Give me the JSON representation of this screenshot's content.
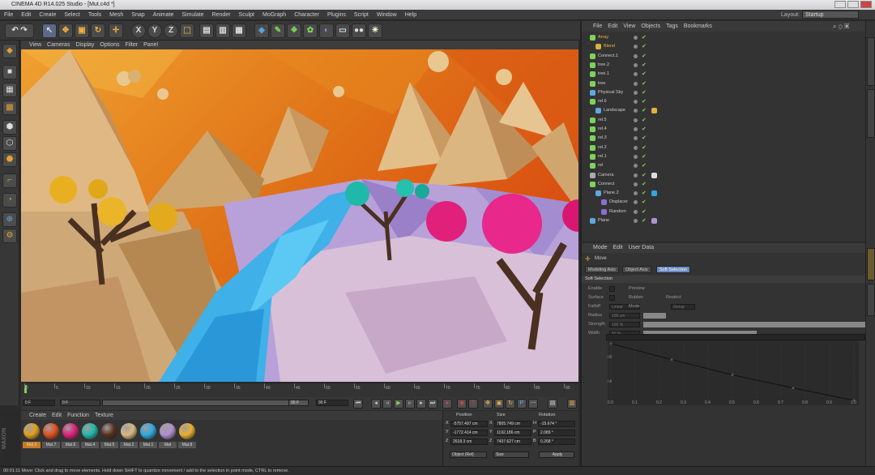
{
  "title": "CINEMA 4D R14.025 Studio - [Mut.c4d *]",
  "menus": [
    "File",
    "Edit",
    "Create",
    "Select",
    "Tools",
    "Mesh",
    "Snap",
    "Animate",
    "Simulate",
    "Render",
    "Sculpt",
    "MoGraph",
    "Character",
    "Plugins",
    "Script",
    "Window",
    "Help"
  ],
  "layout": {
    "label": "Layout:",
    "value": "Startup"
  },
  "toolbar_icons": [
    "undo-icon",
    "live-selection-icon",
    "move-icon",
    "scale-icon",
    "rotate-icon",
    "recent-tool-icon",
    "x-axis-icon",
    "y-axis-icon",
    "z-axis-icon",
    "world-coord-icon",
    "render-view-icon",
    "render-picture-icon",
    "render-settings-icon",
    "cube-icon",
    "pen-icon",
    "subdivide-icon",
    "array-icon",
    "deformer-icon",
    "floor-icon",
    "camera-icon",
    "light-icon"
  ],
  "viewport_menu": [
    "View",
    "Cameras",
    "Display",
    "Options",
    "Filter",
    "Panel"
  ],
  "timeline": {
    "ticks": [
      "0",
      "5",
      "10",
      "15",
      "20",
      "25",
      "30",
      "35",
      "40",
      "45",
      "50",
      "55",
      "60",
      "65",
      "70",
      "75",
      "80",
      "85",
      "90"
    ],
    "current": "0 F",
    "start": "0 F",
    "end": "90 F",
    "end2": "90 F"
  },
  "materials_menu": [
    "Create",
    "Edit",
    "Function",
    "Texture"
  ],
  "materials": [
    {
      "name": "Mat.3",
      "color": "#e0a020"
    },
    {
      "name": "Mat.7",
      "color": "#e05020"
    },
    {
      "name": "Mat.6",
      "color": "#e0207a"
    },
    {
      "name": "Mat.4",
      "color": "#20b8a8"
    },
    {
      "name": "Mat.5",
      "color": "#5a3020"
    },
    {
      "name": "Mat.2",
      "color": "#d8b880"
    },
    {
      "name": "Mat.1",
      "color": "#30a8e0"
    },
    {
      "name": "Mat",
      "color": "#b090d0"
    },
    {
      "name": "Mat.8",
      "color": "#e8b030"
    }
  ],
  "coords": {
    "headers": [
      "Position",
      "Size",
      "Rotation"
    ],
    "rows": [
      {
        "axis": "X",
        "pos": "-5757.497 cm",
        "saxis": "X",
        "size": "7805.749 cm",
        "raxis": "H",
        "rot": "-15.674 °"
      },
      {
        "axis": "Y",
        "pos": "-1772.414 cm",
        "saxis": "Y",
        "size": "1192.186 cm",
        "raxis": "P",
        "rot": "2.089 °"
      },
      {
        "axis": "Z",
        "pos": "2618.3 cm",
        "saxis": "Z",
        "size": "7437.627 cm",
        "raxis": "B",
        "rot": "0.268 °"
      }
    ],
    "mode": "Object (Rel)",
    "size_mode": "Size",
    "apply": "Apply"
  },
  "status": "00:01:11   Move: Click and drag to move elements. Hold down SHIFT to quantize movement / add to the selection in point mode, CTRL to remove.",
  "object_menu": [
    "File",
    "Edit",
    "View",
    "Objects",
    "Tags",
    "Bookmarks"
  ],
  "objects": [
    {
      "name": "Array",
      "indent": 0,
      "icon": "#7dd35a",
      "hl": true
    },
    {
      "name": "Blend",
      "indent": 1,
      "icon": "#d8b040",
      "hl": true
    },
    {
      "name": "Connect.1",
      "indent": 0,
      "icon": "#7dd35a"
    },
    {
      "name": "tree.2",
      "indent": 0,
      "icon": "#7dd35a"
    },
    {
      "name": "tree.1",
      "indent": 0,
      "icon": "#7dd35a"
    },
    {
      "name": "tree",
      "indent": 0,
      "icon": "#7dd35a"
    },
    {
      "name": "Physical Sky",
      "indent": 0,
      "icon": "#5fa8e0"
    },
    {
      "name": "rel.6",
      "indent": 0,
      "icon": "#7dd35a"
    },
    {
      "name": "Landscape",
      "indent": 1,
      "icon": "#5fa8e0",
      "tag": "#e0b040"
    },
    {
      "name": "rel.5",
      "indent": 0,
      "icon": "#7dd35a"
    },
    {
      "name": "rel.4",
      "indent": 0,
      "icon": "#7dd35a"
    },
    {
      "name": "rel.3",
      "indent": 0,
      "icon": "#7dd35a"
    },
    {
      "name": "rel.2",
      "indent": 0,
      "icon": "#7dd35a"
    },
    {
      "name": "rel.1",
      "indent": 0,
      "icon": "#7dd35a"
    },
    {
      "name": "rel",
      "indent": 0,
      "icon": "#7dd35a"
    },
    {
      "name": "Camera",
      "indent": 0,
      "icon": "#aaaaaa",
      "tag": "#ddd"
    },
    {
      "name": "Connect",
      "indent": 0,
      "icon": "#7dd35a"
    },
    {
      "name": "Plane.2",
      "indent": 1,
      "icon": "#5fa8e0",
      "tag": "#30a8e0"
    },
    {
      "name": "Displacer",
      "indent": 2,
      "icon": "#8a6fd0"
    },
    {
      "name": "Random",
      "indent": 2,
      "icon": "#8a6fd0"
    },
    {
      "name": "Plane",
      "indent": 0,
      "icon": "#5fa8e0",
      "tag": "#b090d0"
    }
  ],
  "attr_menu": [
    "Mode",
    "Edit",
    "User Data"
  ],
  "attr_tool": "Move",
  "attr_tabs": [
    "Modeling Axis",
    "Object Axis",
    "Soft Selection"
  ],
  "attr_section": "Soft Selection",
  "attr_rows": [
    {
      "label": "Enable",
      "extra": "Preview"
    },
    {
      "label": "Surface",
      "extra": "Rubber",
      "extra2": "Restrict"
    },
    {
      "label": "Falloff",
      "value": "Linear",
      "extra": "Mode",
      "value2": "Group"
    },
    {
      "label": "Radius",
      "value": "100 cm"
    },
    {
      "label": "Strength",
      "value": "100 %"
    },
    {
      "label": "Width",
      "value": "50 %"
    }
  ],
  "graph": {
    "y_labels": [
      "1",
      "0.8",
      "0.4"
    ],
    "x_labels": [
      "0.0",
      "0.1",
      "0.2",
      "0.3",
      "0.4",
      "0.5",
      "0.6",
      "0.7",
      "0.8",
      "0.9",
      "1.0"
    ],
    "points": [
      [
        0,
        1
      ],
      [
        0.25,
        0.72
      ],
      [
        0.5,
        0.45
      ],
      [
        0.75,
        0.22
      ],
      [
        1,
        0
      ]
    ]
  }
}
